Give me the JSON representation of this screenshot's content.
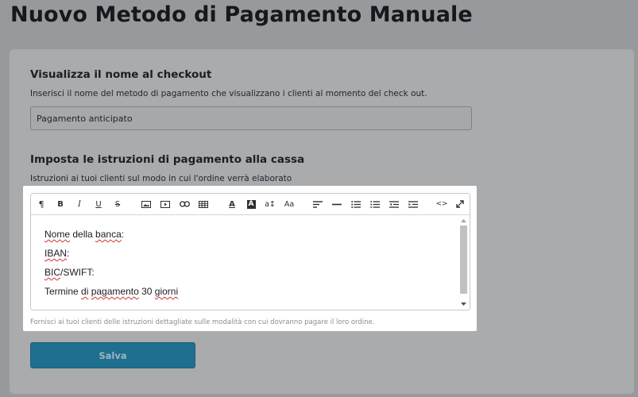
{
  "page": {
    "title": "Nuovo Metodo di Pagamento Manuale"
  },
  "checkout_name": {
    "heading": "Visualizza il nome al checkout",
    "helper": "Inserisci il nome del metodo di pagamento che visualizzano i clienti al momento del check out.",
    "value": "Pagamento anticipato"
  },
  "instructions": {
    "heading": "Imposta le istruzioni di pagamento alla cassa",
    "helper": "Istruzioni ai tuoi clienti sul modo in cui l'ordine verrà elaborato",
    "editor_hint": "Fornisci ai tuoi clienti delle istruzioni dettagliate sulle modalità con cui dovranno pagare il loro ordine.",
    "toolbar": {
      "paragraph_glyph": "¶",
      "bold_glyph": "B",
      "italic_glyph": "I",
      "underline_glyph": "U",
      "strike_glyph": "S",
      "font_color_glyph": "A",
      "bg_color_glyph": "A",
      "font_size_glyph": "a↕",
      "font_family_glyph": "Aa",
      "code_view_glyph": "<>"
    },
    "content": {
      "line1_word1": "Nome",
      "line1_word2": " della ",
      "line1_word3": "banca",
      "line1_end": ":",
      "line2_word": "IBAN",
      "line2_end": ":",
      "line3_word": "BIC",
      "line3_end": "/SWIFT:",
      "line4_start": "Termine ",
      "line4_word1": "di",
      "line4_space": " ",
      "line4_word2": "pagamento",
      "line4_mid": " 30 ",
      "line4_word3": "giorni"
    }
  },
  "actions": {
    "save_label": "Salva"
  },
  "colors": {
    "background": "#979a9d",
    "card": "#a9abad",
    "save_button": "#1e6f90",
    "spellcheck_underline": "#d0342c"
  }
}
